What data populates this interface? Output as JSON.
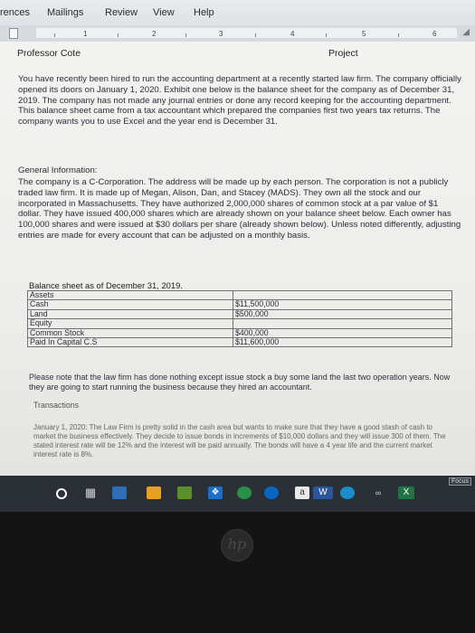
{
  "ribbon": {
    "tabs": [
      "rences",
      "Mailings",
      "Review",
      "View",
      "Help"
    ]
  },
  "ruler": {
    "marks": [
      "1",
      "2",
      "3",
      "4",
      "5",
      "6"
    ]
  },
  "header": {
    "left": "Professor Cote",
    "right": "Project"
  },
  "intro": "You have recently been hired to run the accounting department at a recently started law firm. The company officially opened its doors on January 1, 2020. Exhibit one below is the balance sheet for the company as of December 31, 2019. The company has not made any journal entries or done any record keeping for the accounting department. This balance sheet came from a tax accountant which prepared the companies first two years tax returns. The company wants you to use Excel and the year end is December 31.",
  "general": {
    "heading": "General Information:",
    "body": "The company is a C-Corporation. The address will be made up by each person. The corporation is not a publicly traded law firm. It is made up of Megan, Alison, Dan, and Stacey (MADS). They own all the stock and our incorporated in Massachusetts. They have authorized 2,000,000 shares of common stock at a par value of $1 dollar. They have issued 400,000 shares which are already shown on your balance sheet below. Each owner has 100,000 shares and were issued at $30 dollars per share (already shown below). Unless noted differently, adjusting entries are made for every account that can be adjusted on a monthly basis."
  },
  "balance_sheet": {
    "title": "Balance sheet as of December 31, 2019.",
    "rows": [
      {
        "label": "Assets",
        "value": ""
      },
      {
        "label": "Cash",
        "value": "$11,500,000"
      },
      {
        "label": "Land",
        "value": "$500,000"
      },
      {
        "label": "Equity",
        "value": ""
      },
      {
        "label": "Common Stock",
        "value": "$400,000"
      },
      {
        "label": "Paid In Capital C.S",
        "value": "$11,600,000"
      }
    ]
  },
  "note": "Please note that the law firm has done nothing except issue stock a buy some land the last two operation years. Now they are going to start running the business because they hired an accountant.",
  "transactions": {
    "heading": "Transactions",
    "entry": "January 1, 2020: The Law Firm is pretty solid in the cash area but wants to make sure that they have a good stash of cash to market the business effectively. They decide to issue bonds in increments of $10,000 dollars and they will issue 300 of them. The stated interest rate will be 12% and the interest will be paid annually. The bonds will have a 4 year life and the current market interest rate is 8%."
  },
  "status": {
    "focus": "Focus"
  },
  "brand": "hp"
}
